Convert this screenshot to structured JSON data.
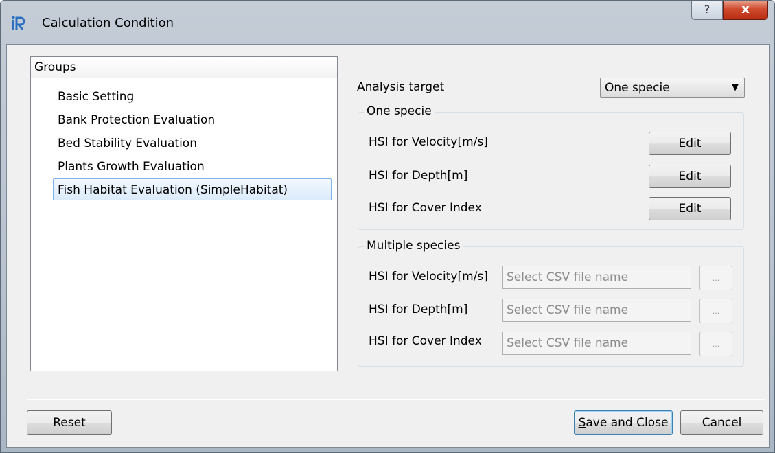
{
  "window": {
    "title": "Calculation Condition",
    "help_label": "?",
    "close_label": "x"
  },
  "groups": {
    "header": "Groups",
    "items": [
      {
        "label": "Basic Setting",
        "selected": false
      },
      {
        "label": "Bank Protection Evaluation",
        "selected": false
      },
      {
        "label": "Bed Stability Evaluation",
        "selected": false
      },
      {
        "label": "Plants Growth Evaluation",
        "selected": false
      },
      {
        "label": "Fish Habitat Evaluation (SimpleHabitat)",
        "selected": true
      }
    ]
  },
  "analysis": {
    "label": "Analysis target",
    "selected": "One specie",
    "arrow": "▼"
  },
  "one_specie": {
    "title": "One specie",
    "rows": [
      {
        "label": "HSI for Velocity[m/s]",
        "button": "Edit"
      },
      {
        "label": "HSI for Depth[m]",
        "button": "Edit"
      },
      {
        "label": "HSI for Cover Index",
        "button": "Edit"
      }
    ]
  },
  "multiple_species": {
    "title": "Multiple species",
    "rows": [
      {
        "label": "HSI for Velocity[m/s]",
        "placeholder": "Select CSV file name",
        "button": "..."
      },
      {
        "label": "HSI for Depth[m]",
        "placeholder": "Select CSV file name",
        "button": "..."
      },
      {
        "label": "HSI for Cover Index",
        "placeholder": "Select CSV file name",
        "button": "..."
      }
    ]
  },
  "footer": {
    "reset": "Reset",
    "save_underlined": "S",
    "save_rest": "ave and Close",
    "cancel": "Cancel"
  },
  "colors": {
    "title_gradient": "#b9c3cf",
    "close_button": "#c7472b",
    "selection": "#dcebfc",
    "selection_border": "#7eb4ea"
  }
}
